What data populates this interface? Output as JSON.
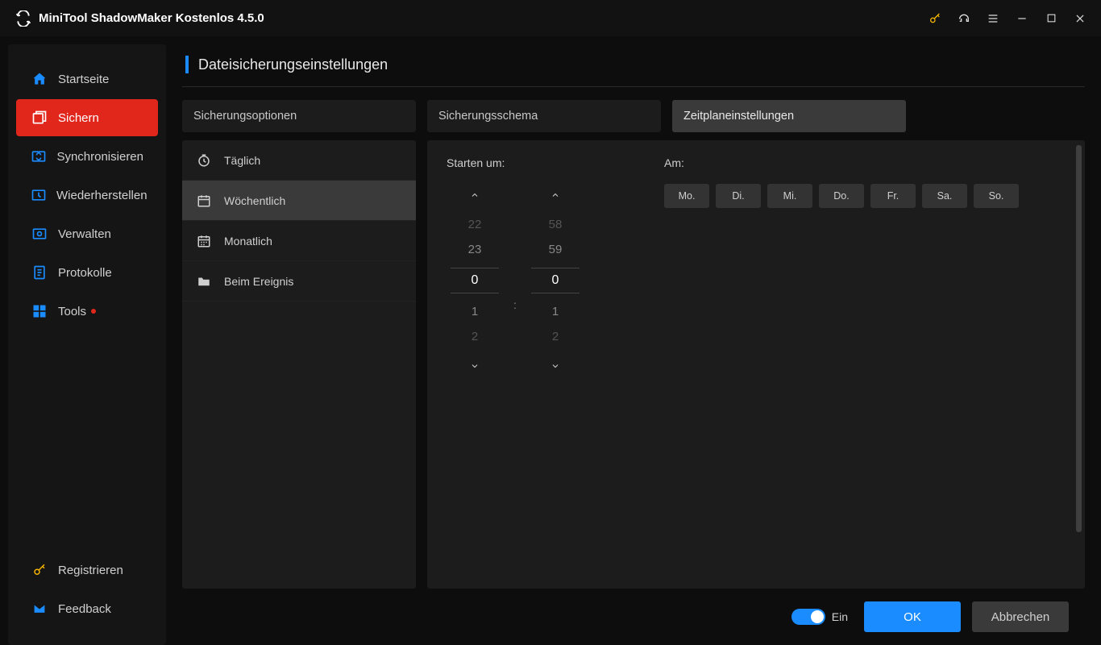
{
  "app": {
    "title": "MiniTool ShadowMaker Kostenlos 4.5.0"
  },
  "sidebar": {
    "items": [
      {
        "label": "Startseite"
      },
      {
        "label": "Sichern"
      },
      {
        "label": "Synchronisieren"
      },
      {
        "label": "Wiederherstellen"
      },
      {
        "label": "Verwalten"
      },
      {
        "label": "Protokolle"
      },
      {
        "label": "Tools"
      }
    ],
    "footer": [
      {
        "label": "Registrieren"
      },
      {
        "label": "Feedback"
      }
    ]
  },
  "page": {
    "title": "Dateisicherungseinstellungen"
  },
  "tabs": [
    {
      "label": "Sicherungsoptionen"
    },
    {
      "label": "Sicherungsschema"
    },
    {
      "label": "Zeitplaneinstellungen"
    }
  ],
  "frequency": [
    {
      "label": "Täglich"
    },
    {
      "label": "Wöchentlich"
    },
    {
      "label": "Monatlich"
    },
    {
      "label": "Beim Ereignis"
    }
  ],
  "schedule": {
    "start_label": "Starten um:",
    "on_label": "Am:",
    "hour": {
      "minus2": "22",
      "minus1": "23",
      "current": "0",
      "plus1": "1",
      "plus2": "2"
    },
    "minute": {
      "minus2": "58",
      "minus1": "59",
      "current": "0",
      "plus1": "1",
      "plus2": "2"
    },
    "separator": ":",
    "days": [
      "Mo.",
      "Di.",
      "Mi.",
      "Do.",
      "Fr.",
      "Sa.",
      "So."
    ]
  },
  "footer": {
    "toggle_label": "Ein",
    "ok": "OK",
    "cancel": "Abbrechen"
  }
}
